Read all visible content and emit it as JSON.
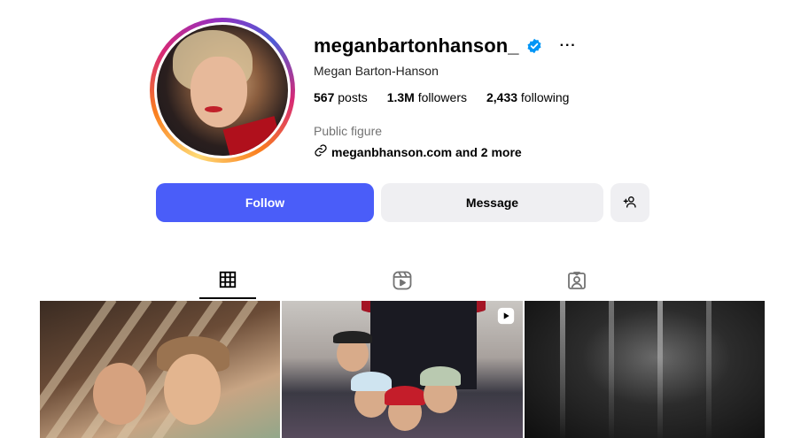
{
  "profile": {
    "username": "meganbartonhanson_",
    "full_name": "Megan Barton-Hanson",
    "verified": true,
    "more_label": "···",
    "stats": {
      "posts_count": "567",
      "posts_label": "posts",
      "followers_count": "1.3M",
      "followers_label": "followers",
      "following_count": "2,433",
      "following_label": "following"
    },
    "category": "Public figure",
    "link_text": "meganbhanson.com and 2 more"
  },
  "actions": {
    "follow_label": "Follow",
    "message_label": "Message",
    "add_icon": "add-person-icon"
  },
  "tabs": [
    {
      "icon": "grid-icon",
      "active": true
    },
    {
      "icon": "reels-icon",
      "active": false
    },
    {
      "icon": "tagged-icon",
      "active": false
    }
  ],
  "colors": {
    "follow_button": "#4a5df9",
    "verified_badge": "#0095f6",
    "secondary_button": "#efeff2"
  }
}
